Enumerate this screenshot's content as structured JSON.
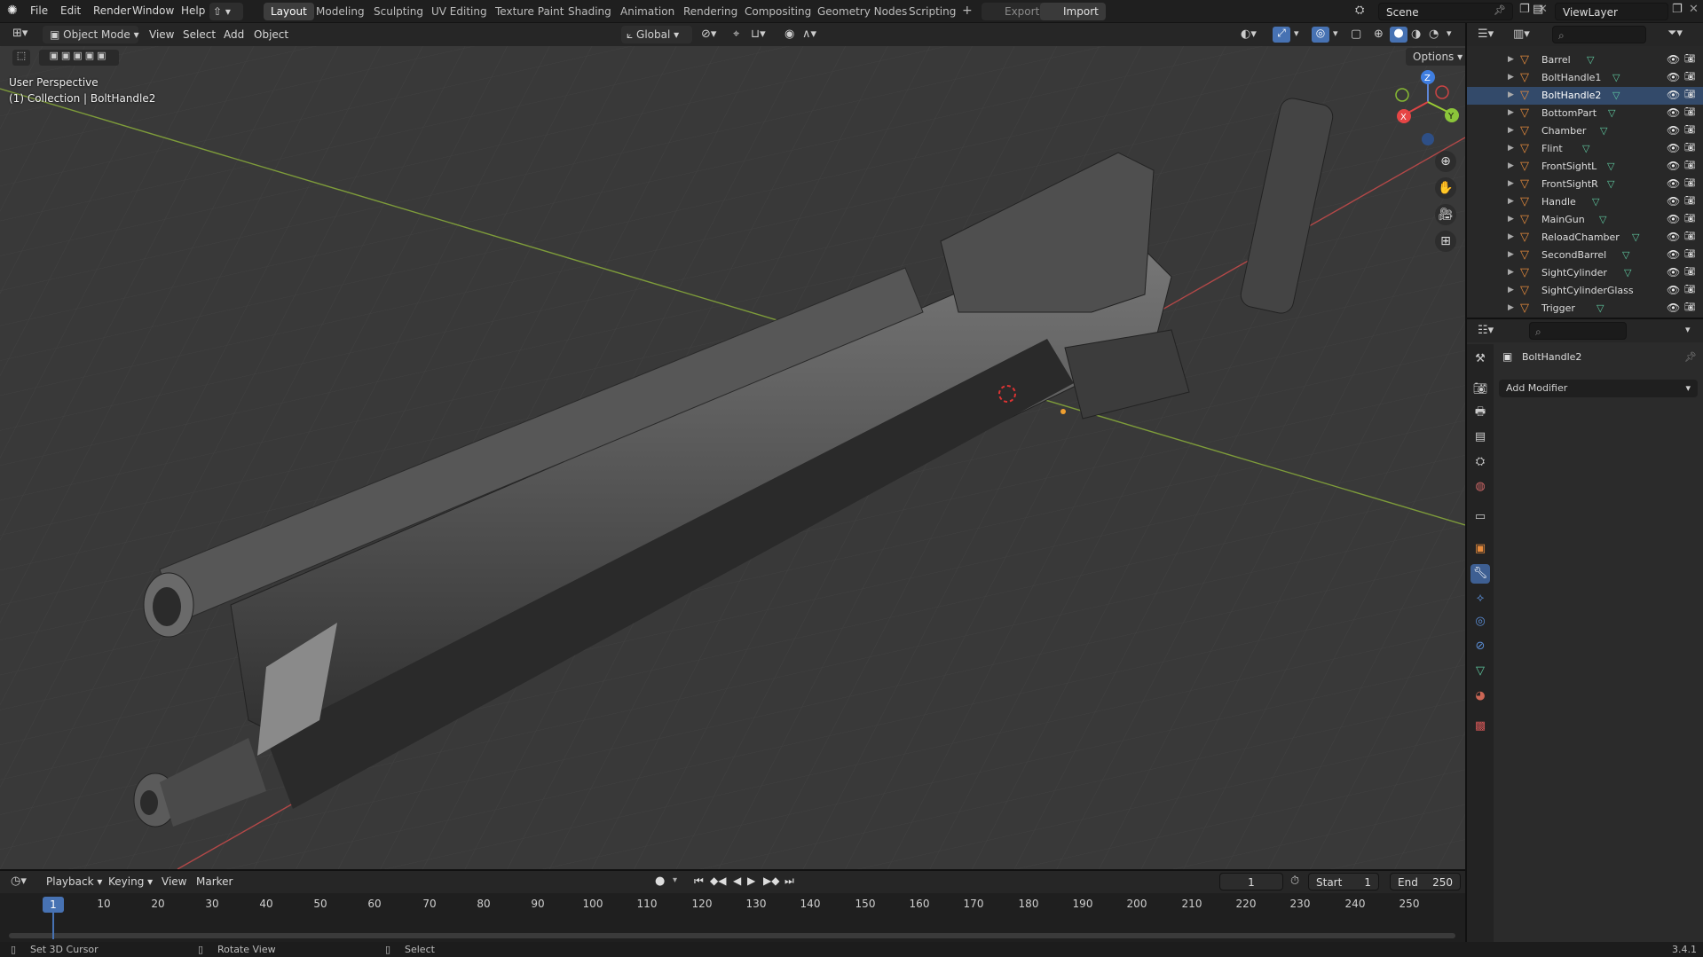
{
  "topbar": {
    "menus": [
      "File",
      "Edit",
      "Render",
      "Window",
      "Help"
    ],
    "workspaces": [
      "Layout",
      "Modeling",
      "Sculpting",
      "UV Editing",
      "Texture Paint",
      "Shading",
      "Animation",
      "Rendering",
      "Compositing",
      "Geometry Nodes",
      "Scripting"
    ],
    "active_workspace": "Layout",
    "export_label": "Export",
    "import_label": "Import",
    "scene_name": "Scene",
    "view_layer": "ViewLayer"
  },
  "viewport_header": {
    "mode": "Object Mode",
    "menus": [
      "View",
      "Select",
      "Add",
      "Object"
    ],
    "orientation": "Global",
    "options_label": "Options"
  },
  "viewport": {
    "perspective_label": "User Perspective",
    "collection_label": "(1) Collection | BoltHandle2",
    "gizmo_axes": {
      "x": "X",
      "y": "Y",
      "z": "Z"
    }
  },
  "outliner": {
    "items": [
      {
        "label": "Barrel"
      },
      {
        "label": "BoltHandle1"
      },
      {
        "label": "BoltHandle2",
        "selected": true
      },
      {
        "label": "BottomPart"
      },
      {
        "label": "Chamber"
      },
      {
        "label": "Flint"
      },
      {
        "label": "FrontSightL"
      },
      {
        "label": "FrontSightR"
      },
      {
        "label": "Handle"
      },
      {
        "label": "MainGun"
      },
      {
        "label": "ReloadChamber"
      },
      {
        "label": "SecondBarrel"
      },
      {
        "label": "SightCylinder"
      },
      {
        "label": "SightCylinderGlass"
      },
      {
        "label": "Trigger"
      }
    ]
  },
  "properties": {
    "object_name": "BoltHandle2",
    "add_modifier_label": "Add Modifier"
  },
  "timeline": {
    "menus": [
      "Playback",
      "Keying",
      "View",
      "Marker"
    ],
    "current_frame": "1",
    "start_label": "Start",
    "start_value": "1",
    "end_label": "End",
    "end_value": "250",
    "ticks": [
      "1",
      "10",
      "20",
      "30",
      "40",
      "50",
      "60",
      "70",
      "80",
      "90",
      "100",
      "110",
      "120",
      "130",
      "140",
      "150",
      "160",
      "170",
      "180",
      "190",
      "200",
      "210",
      "220",
      "230",
      "240",
      "250"
    ]
  },
  "statusbar": {
    "hint1": "Set 3D Cursor",
    "hint2": "Rotate View",
    "hint3": "Select",
    "version": "3.4.1"
  },
  "colors": {
    "accent_blue": "#4772b3",
    "axis_red": "#c84a4a",
    "axis_green": "#8db03f",
    "object_orange": "#e58a3c",
    "mesh_green": "#5fc9a0"
  }
}
